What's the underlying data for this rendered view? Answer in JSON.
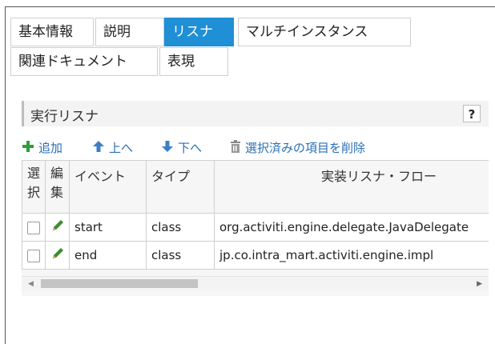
{
  "tabs": {
    "row1": [
      "基本情報",
      "説明",
      "リスナ",
      "マルチインスタンス"
    ],
    "row2": [
      "関連ドキュメント",
      "表現"
    ],
    "active": "リスナ"
  },
  "section": {
    "title": "実行リスナ",
    "help": "?"
  },
  "toolbar": {
    "add": "追加",
    "up": "上へ",
    "down": "下へ",
    "delete": "選択済みの項目を削除"
  },
  "table": {
    "headers": {
      "select_line1": "選",
      "select_line2": "択",
      "edit_line1": "編",
      "edit_line2": "集",
      "event": "イベント",
      "type": "タイプ",
      "impl": "実装リスナ・フロー"
    },
    "rows": [
      {
        "event": "start",
        "type": "class",
        "impl": "org.activiti.engine.delegate.JavaDelegate"
      },
      {
        "event": "end",
        "type": "class",
        "impl": "jp.co.intra_mart.activiti.engine.impl"
      }
    ]
  },
  "colors": {
    "accent": "#1f8fd6",
    "link": "#2a6fb5",
    "add_icon": "#2e9e3a",
    "edit_icon": "#3d8b2f"
  }
}
